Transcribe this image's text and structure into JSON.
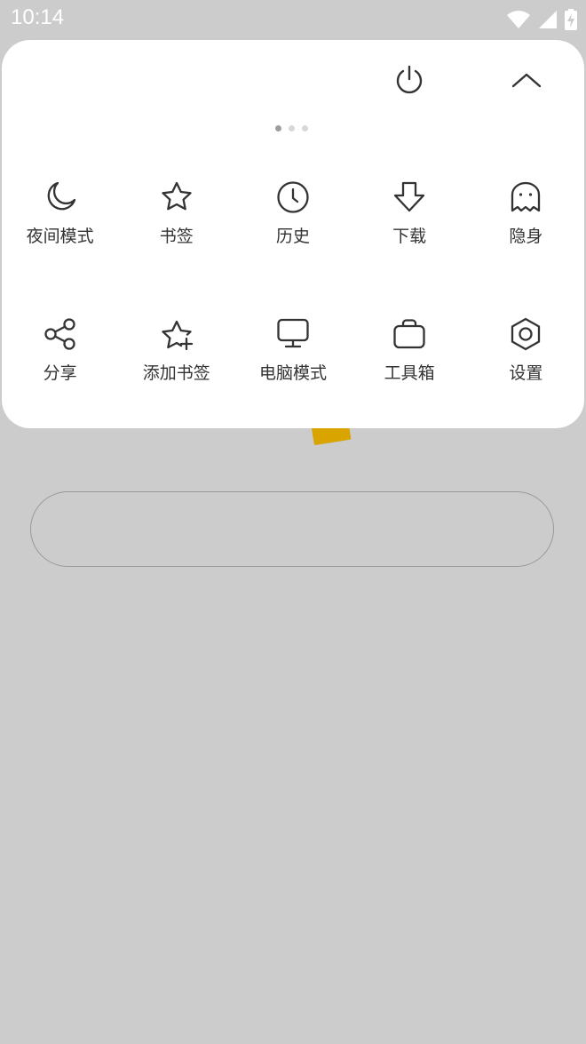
{
  "status_bar": {
    "time": "10:14",
    "icons": [
      "wifi-icon",
      "cellular-signal-icon",
      "battery-charging-icon"
    ]
  },
  "menu": {
    "top_actions": [
      {
        "name": "power-icon"
      },
      {
        "name": "chevron-up-icon"
      }
    ],
    "pagination": {
      "total": 3,
      "active": 0
    },
    "rows": [
      [
        {
          "label": "夜间模式",
          "icon": "moon-icon"
        },
        {
          "label": "书签",
          "icon": "star-icon"
        },
        {
          "label": "历史",
          "icon": "clock-icon"
        },
        {
          "label": "下载",
          "icon": "download-arrow-icon"
        },
        {
          "label": "隐身",
          "icon": "ghost-icon"
        }
      ],
      [
        {
          "label": "分享",
          "icon": "share-icon"
        },
        {
          "label": "添加书签",
          "icon": "star-plus-icon"
        },
        {
          "label": "电脑模式",
          "icon": "monitor-icon"
        },
        {
          "label": "工具箱",
          "icon": "toolbox-icon"
        },
        {
          "label": "设置",
          "icon": "settings-hexagon-icon"
        }
      ]
    ]
  },
  "colors": {
    "overlay": "#cccccc",
    "panel": "#ffffff",
    "icon": "#333333",
    "logo_accent": "#d9a300"
  }
}
